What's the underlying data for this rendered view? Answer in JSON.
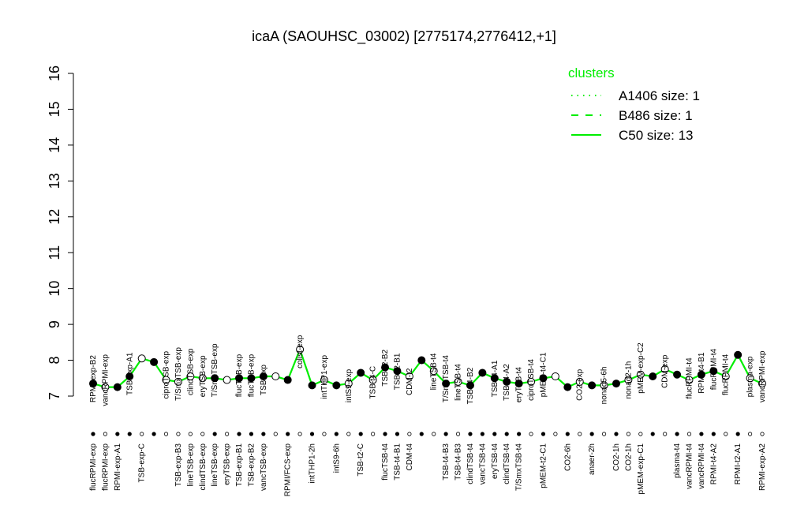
{
  "chart_data": {
    "type": "line",
    "title": "icaA (SAOUHSC_03002) [2775174,2776412,+1]",
    "xlabel": "",
    "ylabel": "",
    "ylim": [
      7,
      16
    ],
    "y_ticks": [
      7,
      8,
      9,
      10,
      11,
      12,
      13,
      14,
      15,
      16
    ],
    "line_color": "#00EE00",
    "legend": {
      "title": "clusters",
      "position": "top-right",
      "entries": [
        {
          "label": "A1406 size: 1",
          "style": "dotted"
        },
        {
          "label": "B486 size: 1",
          "style": "dashed"
        },
        {
          "label": "C50 size: 13",
          "style": "solid"
        }
      ]
    },
    "conditions": [
      {
        "label": "flucRPMI-exp",
        "value": 7.35,
        "top": "RPMI-exp-B2",
        "filled": true
      },
      {
        "label": "flucRPMI-exp",
        "value": 7.25,
        "top": "vancRPMI-exp",
        "filled": false
      },
      {
        "label": "RPMI-exp-A1",
        "value": 7.25,
        "top": "",
        "filled": true
      },
      {
        "label": "",
        "value": 7.55,
        "top": "TSB-exp-A1",
        "filled": true
      },
      {
        "label": "TSB-exp-C",
        "value": 8.05,
        "top": "",
        "filled": false
      },
      {
        "label": "",
        "value": 7.95,
        "top": "",
        "filled": true
      },
      {
        "label": "",
        "value": 7.45,
        "top": "ciproTSB-exp",
        "filled": false
      },
      {
        "label": "TSB-exp-B3",
        "value": 7.4,
        "top": "T/SmxTSB-exp",
        "filled": false
      },
      {
        "label": "lineTSB-exp",
        "value": 7.55,
        "top": "clindTSB-exp",
        "filled": false
      },
      {
        "label": "clindTSB-exp",
        "value": 7.5,
        "top": "eryTSB-exp",
        "filled": false
      },
      {
        "label": "lineTSB-exp",
        "value": 7.5,
        "top": "T/SmxTSB-exp",
        "filled": true
      },
      {
        "label": "eryTSB-exp",
        "value": 7.45,
        "top": "",
        "filled": false
      },
      {
        "label": "TSB-exp-B1",
        "value": 7.5,
        "top": "flucTSB-exp",
        "filled": true
      },
      {
        "label": "TSB-exp-B2",
        "value": 7.5,
        "top": "flucTSB-exp",
        "filled": true
      },
      {
        "label": "vancTSB-exp",
        "value": 7.55,
        "top": "TSB-exp",
        "filled": true
      },
      {
        "label": "",
        "value": 7.55,
        "top": "",
        "filled": false
      },
      {
        "label": "RPMI/FCS-exp",
        "value": 7.45,
        "top": "",
        "filled": true
      },
      {
        "label": "",
        "value": 8.3,
        "top": "colist-exp",
        "filled": false
      },
      {
        "label": "intTHP1-2h",
        "value": 7.3,
        "top": "",
        "filled": true
      },
      {
        "label": "",
        "value": 7.45,
        "top": "intTHP1-exp",
        "filled": false
      },
      {
        "label": "intS9-6h",
        "value": 7.3,
        "top": "",
        "filled": true
      },
      {
        "label": "",
        "value": 7.35,
        "top": "intS9-exp",
        "filled": false
      },
      {
        "label": "TSB-t2-C",
        "value": 7.65,
        "top": "",
        "filled": true
      },
      {
        "label": "",
        "value": 7.45,
        "top": "TSB-t4-C",
        "filled": false
      },
      {
        "label": "flucTSB-t4",
        "value": 7.8,
        "top": "TSB-t2-B2",
        "filled": true
      },
      {
        "label": "TSB-t4-B1",
        "value": 7.7,
        "top": "TSB-t2-B1",
        "filled": true
      },
      {
        "label": "CDM-t4",
        "value": 7.55,
        "top": "CDM-t2",
        "filled": false
      },
      {
        "label": "",
        "value": 8.0,
        "top": "",
        "filled": true
      },
      {
        "label": "",
        "value": 7.7,
        "top": "lineTSB-t4",
        "filled": false
      },
      {
        "label": "TSB-t4-B3",
        "value": 7.35,
        "top": "T/SmxTSB-t4",
        "filled": true
      },
      {
        "label": "TSB-t4-B3",
        "value": 7.4,
        "top": "lineTSB-t4",
        "filled": false
      },
      {
        "label": "clindTSB-t4",
        "value": 7.3,
        "top": "TSB-t4-B2",
        "filled": true
      },
      {
        "label": "vancTSB-t4",
        "value": 7.65,
        "top": "",
        "filled": true
      },
      {
        "label": "eryTSB-t4",
        "value": 7.5,
        "top": "TSB-t4-A1",
        "filled": true
      },
      {
        "label": "clindTSB-t4",
        "value": 7.4,
        "top": "TSB-t4-A2",
        "filled": true
      },
      {
        "label": "T/SmxTSB-t4",
        "value": 7.35,
        "top": "eryTSB-t4",
        "filled": true
      },
      {
        "label": "",
        "value": 7.4,
        "top": "ciproTSB-t4",
        "filled": false
      },
      {
        "label": "pMEM-t2-C1",
        "value": 7.5,
        "top": "pMEM-t4-C1",
        "filled": true
      },
      {
        "label": "",
        "value": 7.55,
        "top": "",
        "filled": false
      },
      {
        "label": "CO2-6h",
        "value": 7.25,
        "top": "",
        "filled": true
      },
      {
        "label": "",
        "value": 7.4,
        "top": "CO2-exp",
        "filled": false
      },
      {
        "label": "anaer-2h",
        "value": 7.3,
        "top": "",
        "filled": true
      },
      {
        "label": "",
        "value": 7.3,
        "top": "nonad5-6h",
        "filled": false
      },
      {
        "label": "CO2-1h",
        "value": 7.35,
        "top": "",
        "filled": true
      },
      {
        "label": "CO2-1h",
        "value": 7.45,
        "top": "nonad2-1h",
        "filled": false
      },
      {
        "label": "pMEM-exp-C1",
        "value": 7.6,
        "top": "pMEM-exp-C2",
        "filled": false
      },
      {
        "label": "",
        "value": 7.55,
        "top": "",
        "filled": true
      },
      {
        "label": "",
        "value": 7.75,
        "top": "CDM-exp",
        "filled": false
      },
      {
        "label": "plasma-t4",
        "value": 7.6,
        "top": "",
        "filled": true
      },
      {
        "label": "vancRPMI-t4",
        "value": 7.45,
        "top": "flucRPMI-t4",
        "filled": false
      },
      {
        "label": "vancRPMI-t4",
        "value": 7.6,
        "top": "RPMI-t4-B1",
        "filled": true
      },
      {
        "label": "RPMI-t4-A2",
        "value": 7.7,
        "top": "flucRPMI-t4",
        "filled": true
      },
      {
        "label": "",
        "value": 7.55,
        "top": "flucRPMI-t4",
        "filled": false
      },
      {
        "label": "RPMI-t2-A1",
        "value": 8.15,
        "top": "",
        "filled": true
      },
      {
        "label": "",
        "value": 7.5,
        "top": "plasma-exp",
        "filled": false
      },
      {
        "label": "RPMI-exp-A2",
        "value": 7.35,
        "top": "vancRPMI-exp",
        "filled": false
      }
    ]
  }
}
